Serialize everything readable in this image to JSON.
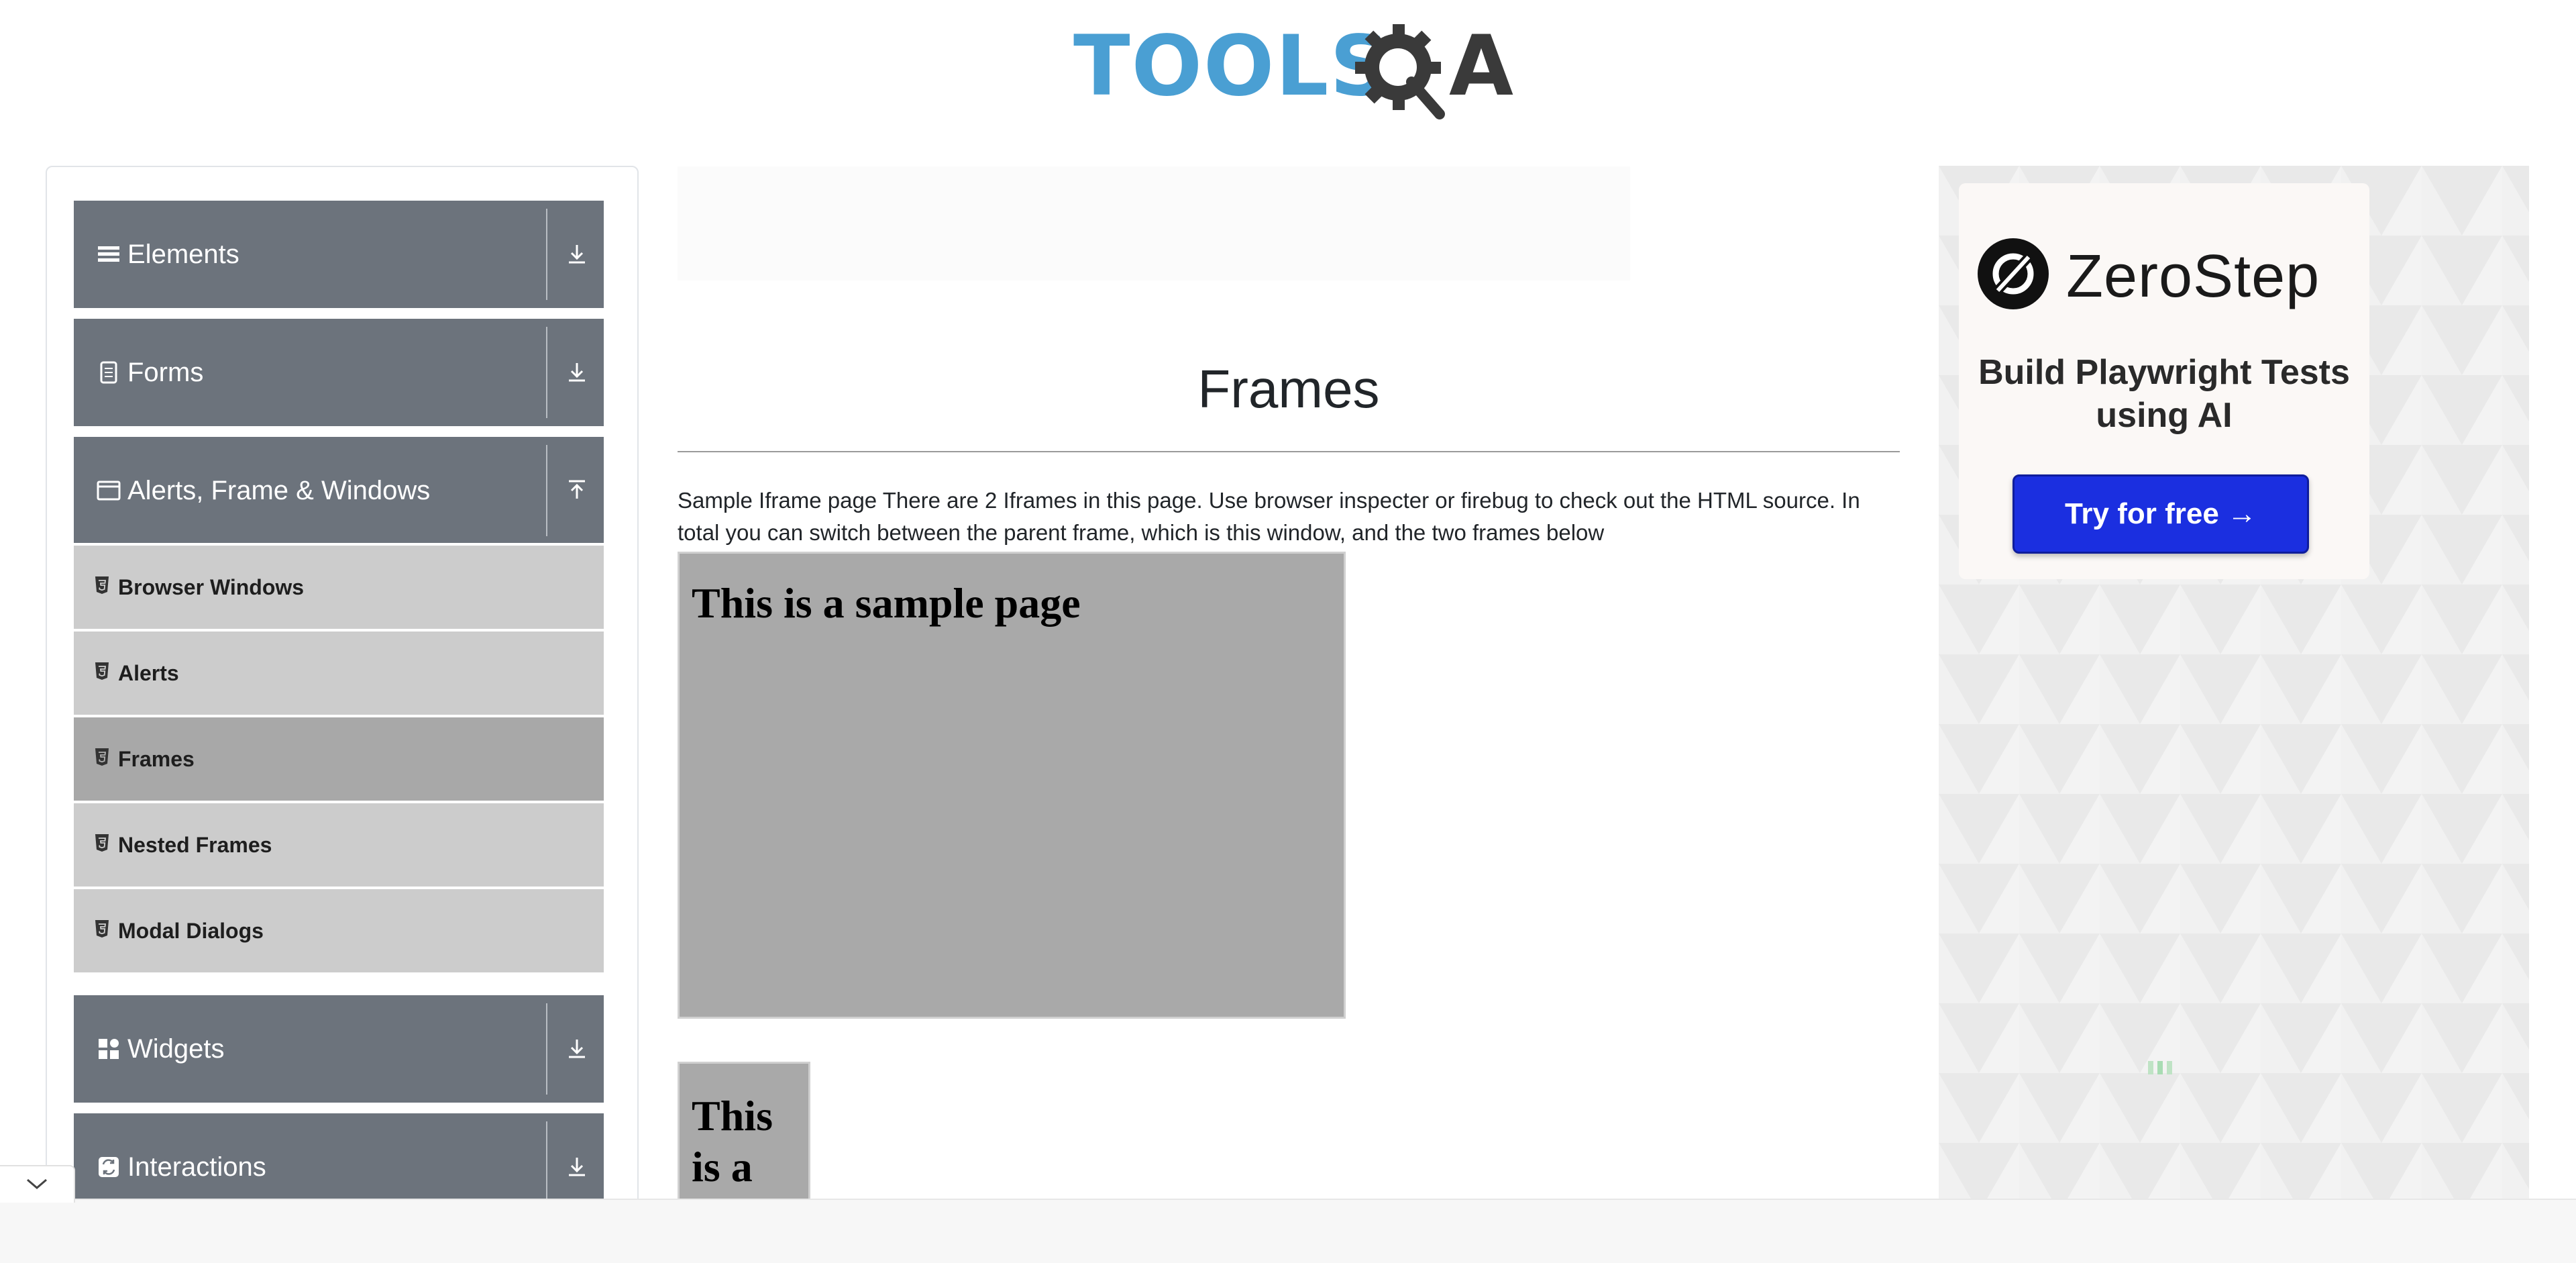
{
  "header": {
    "logo_text_left": "TOOLS",
    "logo_text_right": "A",
    "logo_colors": {
      "tools": "#4a9fd3",
      "qa": "#3a3a3a"
    }
  },
  "sidebar": {
    "groups": [
      {
        "label": "Elements",
        "icon": "list-icon",
        "arrow": "download-icon"
      },
      {
        "label": "Forms",
        "icon": "document-icon",
        "arrow": "download-icon"
      },
      {
        "label": "Alerts, Frame & Windows",
        "icon": "window-icon",
        "arrow": "upload-icon"
      },
      {
        "label": "Widgets",
        "icon": "grid-icon",
        "arrow": "download-icon"
      },
      {
        "label": "Interactions",
        "icon": "interaction-icon",
        "arrow": "download-icon"
      }
    ],
    "subitems": [
      {
        "label": "Browser Windows",
        "active": false
      },
      {
        "label": "Alerts",
        "active": false
      },
      {
        "label": "Frames",
        "active": true
      },
      {
        "label": "Nested Frames",
        "active": false
      },
      {
        "label": "Modal Dialogs",
        "active": false
      }
    ],
    "colors": {
      "header_bg": "#6c737c",
      "subitem_bg": "#cccccc",
      "subitem_active_bg": "#a8a8a8"
    }
  },
  "main": {
    "title": "Frames",
    "intro": "Sample Iframe page There are 2 Iframes in this page. Use browser inspecter or firebug to check out the HTML source. In total you can switch between the parent frame, which is this window, and the two frames below",
    "frame1_heading": "This is a sample page",
    "frame2_heading": "This is a"
  },
  "ad": {
    "brand": "ZeroStep",
    "tagline": "Build Playwright Tests using AI",
    "button": "Try for free →",
    "colors": {
      "button": "#1b2fe0"
    }
  }
}
